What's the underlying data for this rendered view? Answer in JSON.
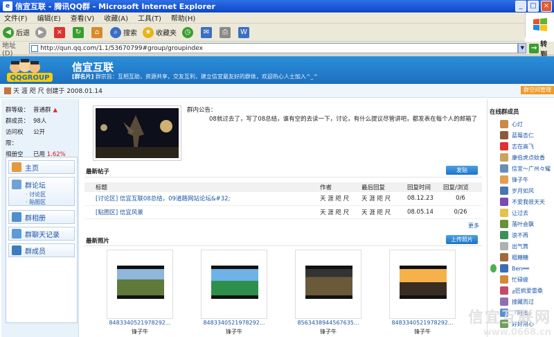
{
  "window": {
    "title": "信宜互联 - 腾讯QQ群 - Microsoft Internet Explorer"
  },
  "menu": [
    "文件(F)",
    "编辑(E)",
    "查看(V)",
    "收藏(A)",
    "工具(T)",
    "帮助(H)"
  ],
  "toolbar": {
    "back": "后退",
    "search": "搜索",
    "favorites": "收藏夹"
  },
  "address": {
    "label": "地址(D)",
    "url": "http://qun.qq.com/1.1/53670799#group/groupindex",
    "go": "转到"
  },
  "banner": {
    "logo_text": "QQGROUP",
    "group_name": "信宜互联",
    "brief_label": "[群名片]",
    "brief_text": "群宗旨：互相互助，资源共享，交友互利，建立信宜最友好的群体，欢迎热心人士加入^_^"
  },
  "info": {
    "creator": "天 涯 咫 尺",
    "created": "创建于 2008.01.14",
    "manage_button": "群空间管理"
  },
  "group_info": {
    "level_label": "群等级：",
    "level_value": "普通群",
    "members_label": "群成员：",
    "members_value": "98人",
    "access_label": "访问权限：",
    "access_value": "公开",
    "space_label": "相册空间：",
    "space_value": "已用",
    "space_used": "1.62%"
  },
  "nav": {
    "home": "主页",
    "forum": "群论坛",
    "forum_sub1": "· 讨论区",
    "forum_sub2": "· 贴图区",
    "album": "群相册",
    "chatlog": "群聊天记录",
    "members": "群成员"
  },
  "notice": {
    "title": "群内公告：",
    "body": "08就过去了，写了08总结，谁有空的去读一下，讨论，有什么提议尽管讲吧，都发表在每个人的邮箱了"
  },
  "posts": {
    "title": "最新帖子",
    "post_button": "发贴",
    "headers": [
      "标题",
      "作者",
      "最后回复",
      "回复时间",
      "回复/浏览"
    ],
    "rows": [
      {
        "title": "[讨论区] 信宜互联08总结，09道路网站论坛&#32;",
        "author": "天 涯 咫 尺",
        "last": "天 涯 咫 尺",
        "time": "08.12.23",
        "stats": "0/6"
      },
      {
        "title": "[贴图区] 信宜风景",
        "author": "天 涯 咫 尺",
        "last": "天 涯 咫 尺",
        "time": "08.05.14",
        "stats": "0/26"
      }
    ],
    "more": "更多"
  },
  "photos": {
    "title": "最新照片",
    "upload_button": "上传照片",
    "items": [
      {
        "name": "848334052197829​2...",
        "by": "锋子牛"
      },
      {
        "name": "848334052197829​2...",
        "by": "锋子牛"
      },
      {
        "name": "856343894456763​5...",
        "by": "锋子牛"
      },
      {
        "name": "848334052197829​2...",
        "by": "锋子牛"
      }
    ]
  },
  "members_panel": {
    "title": "在线群成员",
    "list": [
      "心灯",
      "蓝莓杏仁",
      "志在高飞",
      "康伯虎点蚊香",
      "信宜～广州々耀",
      "锋子牛",
      "岁月如风",
      "不爱我很天天",
      "让过去",
      "落叶会飘",
      "浪不再",
      "出气筒",
      "粗糖糖",
      "Ben══",
      "忙碌疲",
      "╓匠疯爱雷桑",
      "搜藏而过",
      "『阿清』",
      "好好用心"
    ]
  },
  "watermark": {
    "title": "信宜互联网",
    "url": "www.0668.cn"
  },
  "colors": {
    "banner": "#1d6fbf",
    "link": "#1a55a5",
    "accent_orange": "#f09b2b"
  }
}
